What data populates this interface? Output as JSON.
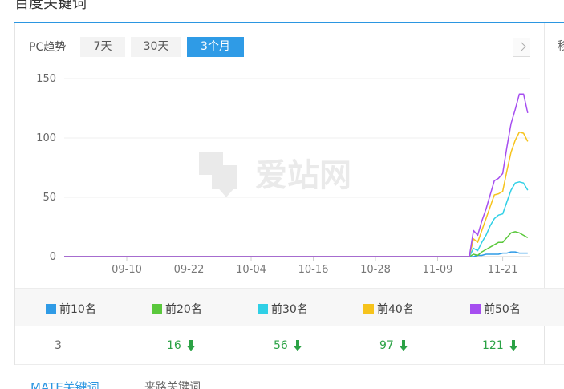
{
  "page": {
    "title": "百度关键词",
    "side_text": "移"
  },
  "toolbar": {
    "label": "PC趋势",
    "ranges": [
      {
        "label": "7天"
      },
      {
        "label": "30天"
      },
      {
        "label": "3个月"
      }
    ],
    "active_range": "3个月"
  },
  "watermark": {
    "text": "爱站网"
  },
  "chart_data": {
    "type": "line",
    "title": "",
    "xlabel": "",
    "ylabel": "",
    "ylim": [
      0,
      150
    ],
    "yticks": [
      0,
      50,
      100,
      150
    ],
    "xticks": [
      "09-10",
      "09-22",
      "10-04",
      "10-16",
      "10-28",
      "11-09",
      "11-21"
    ],
    "x": [
      "08-30",
      "09-10",
      "09-22",
      "10-04",
      "10-16",
      "10-28",
      "11-09",
      "11-13",
      "11-14",
      "11-15",
      "11-16",
      "11-17",
      "11-18",
      "11-19",
      "11-20",
      "11-21",
      "11-22",
      "11-23",
      "11-24",
      "11-25",
      "11-26",
      "11-27"
    ],
    "grid": true,
    "series": [
      {
        "name": "前10名",
        "color": "#2f9be6",
        "values": [
          0,
          0,
          0,
          0,
          0,
          0,
          0,
          0,
          0,
          1,
          1,
          2,
          2,
          2,
          2,
          3,
          3,
          4,
          4,
          3,
          3,
          3
        ]
      },
      {
        "name": "前20名",
        "color": "#5ac83c",
        "values": [
          0,
          0,
          0,
          0,
          0,
          0,
          0,
          0,
          2,
          1,
          4,
          6,
          8,
          10,
          12,
          12,
          16,
          20,
          21,
          20,
          18,
          16
        ]
      },
      {
        "name": "前30名",
        "color": "#2fd0e6",
        "values": [
          0,
          0,
          0,
          0,
          0,
          0,
          0,
          0,
          7,
          5,
          12,
          18,
          26,
          32,
          35,
          36,
          46,
          56,
          62,
          63,
          62,
          56
        ]
      },
      {
        "name": "前40名",
        "color": "#f6c31c",
        "values": [
          0,
          0,
          0,
          0,
          0,
          0,
          0,
          0,
          15,
          12,
          22,
          32,
          42,
          52,
          53,
          55,
          72,
          88,
          98,
          105,
          104,
          97
        ]
      },
      {
        "name": "前50名",
        "color": "#a64ef0",
        "values": [
          0,
          0,
          0,
          0,
          0,
          0,
          0,
          0,
          22,
          18,
          30,
          40,
          52,
          64,
          66,
          70,
          92,
          112,
          124,
          137,
          137,
          121
        ]
      }
    ]
  },
  "legend": [
    {
      "label": "前10名",
      "color": "#2f9be6"
    },
    {
      "label": "前20名",
      "color": "#5ac83c"
    },
    {
      "label": "前30名",
      "color": "#2fd0e6"
    },
    {
      "label": "前40名",
      "color": "#f6c31c"
    },
    {
      "label": "前50名",
      "color": "#a64ef0"
    }
  ],
  "values": [
    {
      "value": "3",
      "trend": "flat"
    },
    {
      "value": "16",
      "trend": "down"
    },
    {
      "value": "56",
      "trend": "down"
    },
    {
      "value": "97",
      "trend": "down"
    },
    {
      "value": "121",
      "trend": "down"
    }
  ],
  "bottom_tabs": [
    {
      "label": "MATE关键词"
    },
    {
      "label": "来路关键词"
    }
  ]
}
